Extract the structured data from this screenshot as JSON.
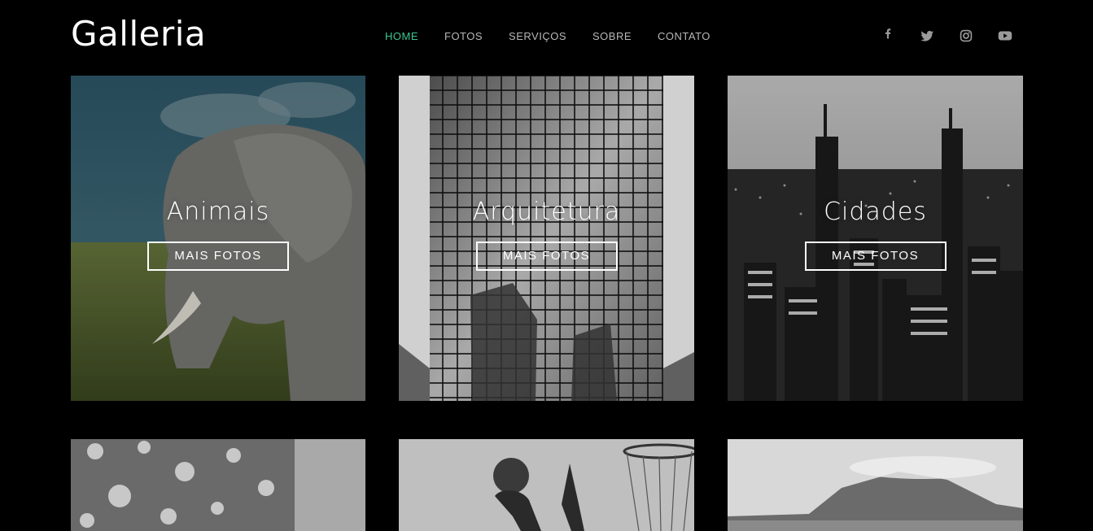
{
  "brand": {
    "logo": "Galleria"
  },
  "nav": {
    "items": [
      {
        "label": "HOME",
        "active": true
      },
      {
        "label": "FOTOS",
        "active": false
      },
      {
        "label": "SERVIÇOS",
        "active": false
      },
      {
        "label": "SOBRE",
        "active": false
      },
      {
        "label": "CONTATO",
        "active": false
      }
    ]
  },
  "social": [
    {
      "icon": "facebook-icon"
    },
    {
      "icon": "twitter-icon"
    },
    {
      "icon": "instagram-icon"
    },
    {
      "icon": "youtube-icon"
    }
  ],
  "colors": {
    "accent": "#3ec78f",
    "background": "#000000",
    "nav_text": "#b8b8b8"
  },
  "gallery": {
    "cards": [
      {
        "title": "Animais",
        "button": "MAIS FOTOS",
        "photo": "elephant-photo"
      },
      {
        "title": "Arquitetura",
        "button": "MAIS FOTOS",
        "photo": "building-photo"
      },
      {
        "title": "Cidades",
        "button": "MAIS FOTOS",
        "photo": "city-skyline-photo"
      }
    ],
    "row2": [
      {
        "photo": "bokeh-lights-photo"
      },
      {
        "photo": "basketball-player-photo"
      },
      {
        "photo": "mountain-landscape-photo"
      }
    ]
  }
}
